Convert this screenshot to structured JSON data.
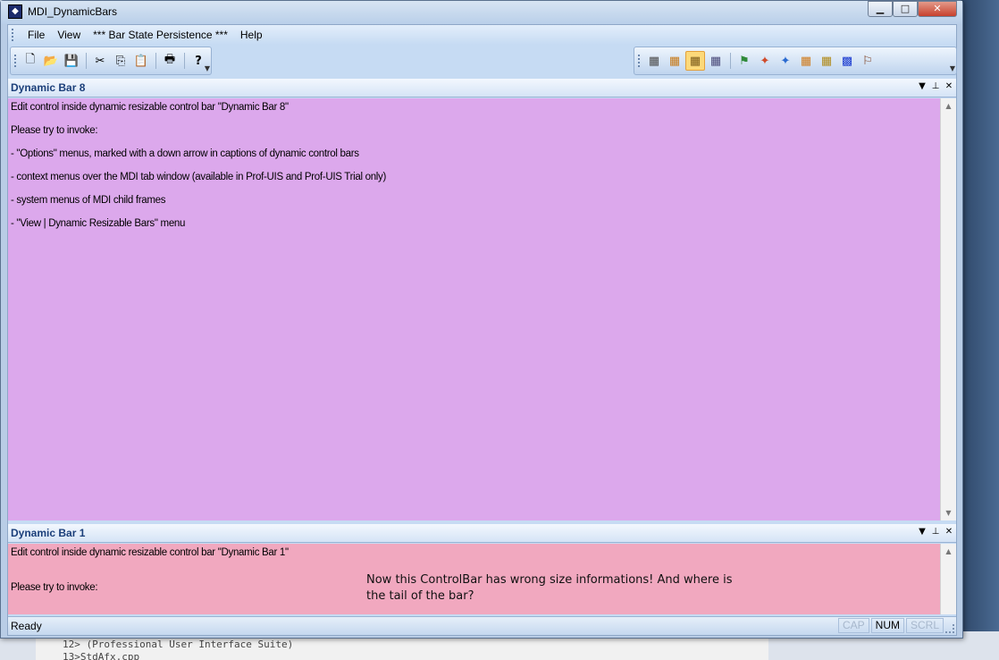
{
  "window": {
    "title": "MDI_DynamicBars",
    "minimize": "▁",
    "maximize": "□",
    "close": "✕"
  },
  "menu": {
    "items": [
      "File",
      "View",
      "*** Bar State Persistence ***",
      "Help"
    ]
  },
  "toolbar_left": {
    "buttons": [
      {
        "name": "new-icon",
        "glyph": "🗋"
      },
      {
        "name": "open-icon",
        "glyph": "📂"
      },
      {
        "name": "save-icon",
        "glyph": "💾"
      },
      {
        "name": "cut-icon",
        "glyph": "✂"
      },
      {
        "name": "copy-icon",
        "glyph": "⎘"
      },
      {
        "name": "paste-icon",
        "glyph": "📋"
      },
      {
        "name": "print-icon",
        "glyph": "🖶"
      },
      {
        "name": "help-icon",
        "glyph": "?"
      }
    ]
  },
  "toolbar_right": {
    "buttons": [
      {
        "name": "theme-2000-icon",
        "glyph": "▦"
      },
      {
        "name": "theme-xp-icon",
        "glyph": "▦"
      },
      {
        "name": "theme-2003-icon",
        "glyph": "▦",
        "active": true
      },
      {
        "name": "theme-studio-icon",
        "glyph": "▦"
      },
      {
        "name": "windows-flag-icon",
        "glyph": "⚑"
      },
      {
        "name": "office-8-icon",
        "glyph": "✦"
      },
      {
        "name": "office-5-icon",
        "glyph": "✦"
      },
      {
        "name": "theme-orange-icon",
        "glyph": "▦"
      },
      {
        "name": "theme-gold-icon",
        "glyph": "▦"
      },
      {
        "name": "theme-color-icon",
        "glyph": "▩"
      },
      {
        "name": "theme-xp-flag-icon",
        "glyph": "⚐"
      }
    ]
  },
  "bar8": {
    "title": "Dynamic Bar 8",
    "lines": [
      "Edit control inside dynamic resizable control bar \"Dynamic Bar 8\"",
      "",
      "Please try to invoke:",
      "",
      "- \"Options\" menus, marked with a down arrow in captions of dynamic control bars",
      "",
      "- context menus over the MDI tab window (available in Prof-UIS and Prof-UIS Trial only)",
      "",
      "- system menus of MDI child frames",
      "",
      "- \"View | Dynamic Resizable Bars\" menu"
    ],
    "colors": {
      "background": "#dca8ec"
    }
  },
  "bar1": {
    "title": "Dynamic Bar 1",
    "lines": [
      "Edit control inside dynamic resizable control bar \"Dynamic Bar 1\"",
      "",
      "",
      "Please try to invoke:",
      ""
    ],
    "colors": {
      "background": "#f1a8bf"
    }
  },
  "caption_buttons": {
    "options": "▼",
    "pin": "⊥",
    "close": "✕"
  },
  "annotation": {
    "line1": "Now this ControlBar has wrong size informations! And where is",
    "line2": "the tail of the bar?"
  },
  "status": {
    "text": "Ready",
    "indicators": [
      {
        "label": "CAP",
        "on": false
      },
      {
        "label": "NUM",
        "on": true
      },
      {
        "label": "SCRL",
        "on": false
      }
    ]
  },
  "background_ide": {
    "line1": "12>      (Professional User Interface Suite)",
    "line2": "13>StdAfx.cpp"
  }
}
